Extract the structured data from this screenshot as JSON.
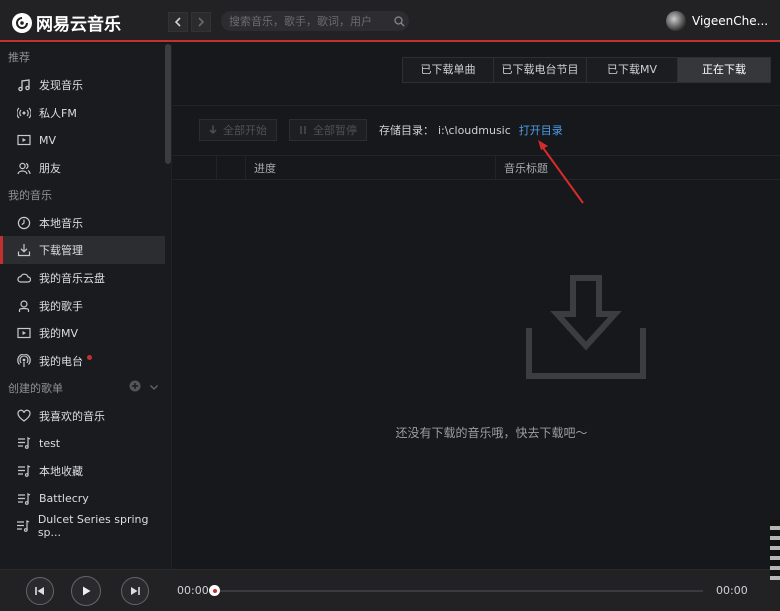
{
  "app": {
    "logo_text": "网易云音乐"
  },
  "header": {
    "search_placeholder": "搜索音乐，歌手，歌词，用户",
    "username": "VigeenChe..."
  },
  "sidebar": {
    "sections": [
      {
        "title": "推荐",
        "items": [
          {
            "label": "发现音乐",
            "icon": "music-note-icon"
          },
          {
            "label": "私人FM",
            "icon": "radio-icon"
          },
          {
            "label": "MV",
            "icon": "video-icon"
          },
          {
            "label": "朋友",
            "icon": "friends-icon"
          }
        ]
      },
      {
        "title": "我的音乐",
        "items": [
          {
            "label": "本地音乐",
            "icon": "clock-icon"
          },
          {
            "label": "下载管理",
            "icon": "download-icon",
            "active": true
          },
          {
            "label": "我的音乐云盘",
            "icon": "cloud-icon"
          },
          {
            "label": "我的歌手",
            "icon": "singer-icon"
          },
          {
            "label": "我的MV",
            "icon": "video-icon"
          },
          {
            "label": "我的电台",
            "icon": "podcast-icon",
            "badge": true
          }
        ]
      },
      {
        "title": "创建的歌单",
        "items": [
          {
            "label": "我喜欢的音乐",
            "icon": "heart-icon"
          },
          {
            "label": "test",
            "icon": "playlist-icon"
          },
          {
            "label": "本地收藏",
            "icon": "playlist-icon"
          },
          {
            "label": "Battlecry",
            "icon": "playlist-icon"
          },
          {
            "label": "Dulcet Series spring sp...",
            "icon": "playlist-icon"
          }
        ]
      }
    ]
  },
  "main": {
    "tabs": [
      {
        "label": "已下载单曲"
      },
      {
        "label": "已下载电台节目"
      },
      {
        "label": "已下载MV"
      },
      {
        "label": "正在下载",
        "active": true
      }
    ],
    "toolbar": {
      "start_all": "全部开始",
      "pause_all": "全部暂停",
      "storage_label": "存储目录：",
      "storage_path": "i:\\cloudmusic",
      "open_dir": "打开目录"
    },
    "columns": [
      "",
      "",
      "进度",
      "音乐标题"
    ],
    "empty_text": "还没有下载的音乐哦，快去下载吧～"
  },
  "player": {
    "current_time": "00:00",
    "total_time": "00:00",
    "progress": 0
  },
  "colors": {
    "accent": "#c62f2f",
    "link": "#4d9fe8",
    "annotation_arrow": "#d62b2b"
  }
}
